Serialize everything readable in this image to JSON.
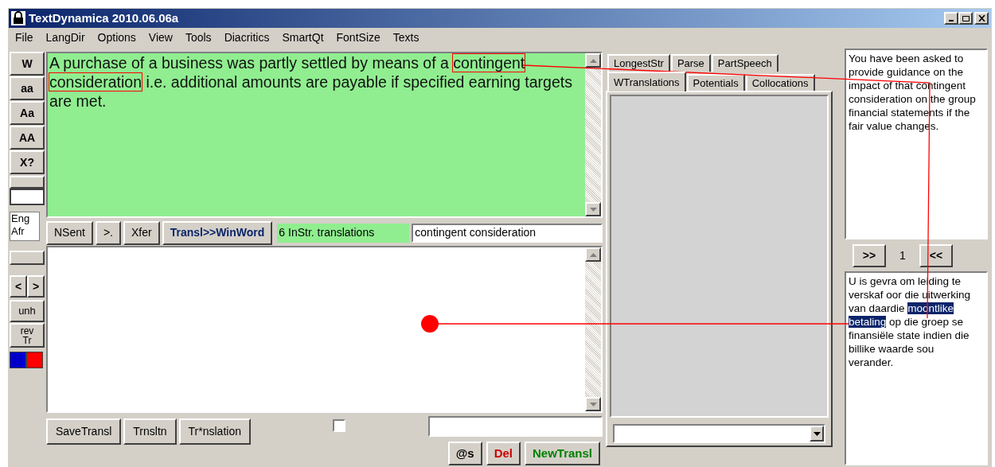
{
  "window": {
    "title": "TextDynamica 2010.06.06a"
  },
  "menu": [
    "File",
    "LangDir",
    "Options",
    "View",
    "Tools",
    "Diacritics",
    "SmartQt",
    "FontSize",
    "Texts"
  ],
  "left_toolbar": {
    "buttons": [
      "W",
      "aa",
      "Aa",
      "AA",
      "X?"
    ],
    "languages": [
      "Eng",
      "Afr"
    ],
    "nav_buttons": [
      "<",
      ">"
    ],
    "unhighlight": "unh",
    "reverse": [
      "rev",
      "Tr"
    ],
    "swatches": [
      {
        "color": "#0000cc"
      },
      {
        "color": "#ff0000"
      }
    ]
  },
  "source": {
    "segments": [
      {
        "text": "A purchase of a business was partly settled by means of a ",
        "boxed": false
      },
      {
        "text": "contingent",
        "boxed": true
      },
      {
        "text": "consideration",
        "boxed": true
      },
      {
        "text": " i.e. additional amounts are payable if specified earning targets are met.",
        "boxed": false
      }
    ]
  },
  "action_bar": {
    "buttons": [
      {
        "label": "NSent",
        "kind": "plain"
      },
      {
        "label": ">.",
        "kind": "plain"
      },
      {
        "label": "Xfer",
        "kind": "plain"
      },
      {
        "label": "Transl>>WinWord",
        "kind": "navy"
      }
    ],
    "status": "6 InStr. translations",
    "term": "contingent consideration"
  },
  "bottom": {
    "buttons": [
      "SaveTransl",
      "Trnsltn",
      "Tr*nslation"
    ],
    "checkbox": {
      "checked": false
    },
    "actions": [
      {
        "label": "@s",
        "kind": "plain"
      },
      {
        "label": "Del",
        "kind": "red"
      },
      {
        "label": "NewTransl",
        "kind": "green"
      }
    ]
  },
  "tabs": {
    "row_1": [
      {
        "label": "LongestStr",
        "selected": false
      },
      {
        "label": "Parse",
        "selected": false
      },
      {
        "label": "PartSpeech",
        "selected": false
      }
    ],
    "row_2": [
      {
        "label": "WTranslations",
        "selected": true
      },
      {
        "label": "Potentials",
        "selected": false
      },
      {
        "label": "Collocations",
        "selected": false
      }
    ]
  },
  "right": {
    "english_text": "You have been asked to provide guidance on the impact of that contingent consideration on the group financial statements if the fair value changes.",
    "pager": {
      "next": ">>",
      "page": "1",
      "prev": "<<"
    },
    "afrikaans": [
      {
        "text": "U is gevra om leiding te verskaf oor die uitwerking van daardie ",
        "selected": false
      },
      {
        "text": "moontlike betaling",
        "selected": true
      },
      {
        "text": " op die groep se finansiële state indien die billike waarde sou verander.",
        "selected": false
      }
    ]
  }
}
